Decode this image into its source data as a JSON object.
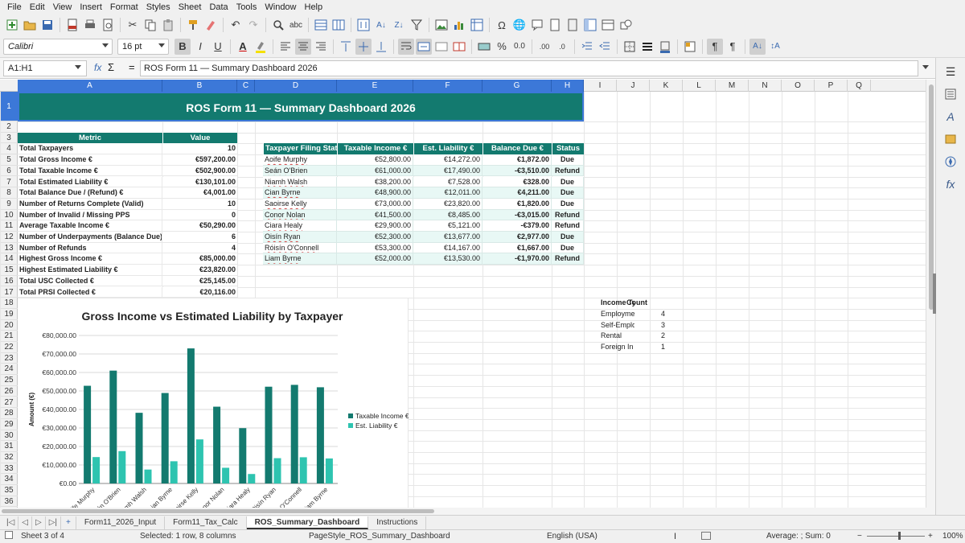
{
  "menu": [
    "File",
    "Edit",
    "View",
    "Insert",
    "Format",
    "Styles",
    "Sheet",
    "Data",
    "Tools",
    "Window",
    "Help"
  ],
  "font": {
    "name": "Calibri",
    "size": "16 pt"
  },
  "namebox": "A1:H1",
  "formula_symbols": {
    "fx": "fx",
    "sigma": "Σ",
    "equals": "="
  },
  "formula": "ROS Form 11 — Summary Dashboard 2026",
  "columns": [
    "A",
    "B",
    "C",
    "D",
    "E",
    "F",
    "G",
    "H",
    "I",
    "J",
    "K",
    "L",
    "M",
    "N",
    "O",
    "P",
    "Q"
  ],
  "rows": [
    "1",
    "2",
    "3",
    "4",
    "5",
    "6",
    "7",
    "8",
    "9",
    "10",
    "11",
    "12",
    "13",
    "14",
    "15",
    "16",
    "17",
    "18",
    "19",
    "20",
    "21",
    "22",
    "23",
    "24",
    "25",
    "26",
    "27",
    "28",
    "29",
    "30",
    "31",
    "32",
    "33",
    "34",
    "35",
    "36"
  ],
  "title": "ROS Form 11 — Summary Dashboard 2026",
  "metrics": {
    "header": [
      "Metric",
      "Value"
    ],
    "rows": [
      [
        "Total Taxpayers",
        "10"
      ],
      [
        "Total Gross Income €",
        "€597,200.00"
      ],
      [
        "Total Taxable Income €",
        "€502,900.00"
      ],
      [
        "Total Estimated Liability €",
        "€130,101.00"
      ],
      [
        "Total Balance Due / (Refund) €",
        "€4,001.00"
      ],
      [
        "Number of Returns Complete (Valid)",
        "10"
      ],
      [
        "Number of Invalid / Missing PPS",
        "0"
      ],
      [
        "Average Taxable Income €",
        "€50,290.00"
      ],
      [
        "Number of Underpayments (Balance Due)",
        "6"
      ],
      [
        "Number of Refunds",
        "4"
      ],
      [
        "Highest Gross Income €",
        "€85,000.00"
      ],
      [
        "Highest Estimated Liability €",
        "€23,820.00"
      ],
      [
        "Total USC Collected €",
        "€25,145.00"
      ],
      [
        "Total PRSI Collected €",
        "€20,116.00"
      ]
    ]
  },
  "status_table": {
    "header": [
      "Taxpayer Filing Status",
      "Taxable Income €",
      "Est. Liability €",
      "Balance Due €",
      "Status"
    ],
    "rows": [
      [
        "Aoife Murphy",
        "€52,800.00",
        "€14,272.00",
        "€1,872.00",
        "Due"
      ],
      [
        "Seán O'Brien",
        "€61,000.00",
        "€17,490.00",
        "-€3,510.00",
        "Refund"
      ],
      [
        "Niamh Walsh",
        "€38,200.00",
        "€7,528.00",
        "€328.00",
        "Due"
      ],
      [
        "Cian Byrne",
        "€48,900.00",
        "€12,011.00",
        "€4,211.00",
        "Due"
      ],
      [
        "Saoirse Kelly",
        "€73,000.00",
        "€23,820.00",
        "€1,820.00",
        "Due"
      ],
      [
        "Conor Nolan",
        "€41,500.00",
        "€8,485.00",
        "-€3,015.00",
        "Refund"
      ],
      [
        "Ciara Healy",
        "€29,900.00",
        "€5,121.00",
        "-€379.00",
        "Refund"
      ],
      [
        "Oisín Ryan",
        "€52,300.00",
        "€13,677.00",
        "€2,977.00",
        "Due"
      ],
      [
        "Róisín O'Connell",
        "€53,300.00",
        "€14,167.00",
        "€1,667.00",
        "Due"
      ],
      [
        "Liam Byrne",
        "€52,000.00",
        "€13,530.00",
        "-€1,970.00",
        "Refund"
      ]
    ]
  },
  "income_types": {
    "header": [
      "Income Ty",
      "Count"
    ],
    "rows": [
      [
        "Employme",
        "4"
      ],
      [
        "Self-Emplo",
        "3"
      ],
      [
        "Rental",
        "2"
      ],
      [
        "Foreign In",
        "1"
      ]
    ]
  },
  "chart_data": {
    "type": "bar",
    "title": "Gross Income vs Estimated Liability by Taxpayer",
    "ylabel": "Amount (€)",
    "xlabel": "",
    "ylim": [
      0,
      80000
    ],
    "yticks": [
      "€0.00",
      "€10,000.00",
      "€20,000.00",
      "€30,000.00",
      "€40,000.00",
      "€50,000.00",
      "€60,000.00",
      "€70,000.00",
      "€80,000.00"
    ],
    "categories": [
      "Aoife Murphy",
      "Seán O'Brien",
      "Niamh Walsh",
      "Cian Byrne",
      "Saoirse Kelly",
      "Conor Nolan",
      "Ciara Healy",
      "Oisín Ryan",
      "O'Connell",
      "Liam Byrne"
    ],
    "category_labels": [
      "ife Murphy",
      "án O'Brien",
      "amh Walsh",
      "ian Byrne",
      "oirse Kelly",
      "onor Nolan",
      "iara Healy",
      "Oisín Ryan",
      "O'Connell",
      "Liam Byrne"
    ],
    "series": [
      {
        "name": "Taxable Income €",
        "color": "#137a6f",
        "values": [
          52800,
          61000,
          38200,
          48900,
          73000,
          41500,
          29900,
          52300,
          53300,
          52000
        ]
      },
      {
        "name": "Est. Liability €",
        "color": "#2ec4b0",
        "values": [
          14272,
          17490,
          7528,
          12011,
          23820,
          8485,
          5121,
          13677,
          14167,
          13530
        ]
      }
    ],
    "legend_position": "right",
    "grid": true
  },
  "tabs": [
    "Form11_2026_Input",
    "Form11_Tax_Calc",
    "ROS_Summary_Dashboard",
    "Instructions"
  ],
  "active_tab": "ROS_Summary_Dashboard",
  "status": {
    "sheet": "Sheet 3 of 4",
    "selection": "Selected: 1 row, 8 columns",
    "pagestyle": "PageStyle_ROS_Summary_Dashboard",
    "language": "English (USA)",
    "summary": "Average: ; Sum: 0",
    "zoom": "100%"
  },
  "colors": {
    "teal": "#137a6f",
    "light_teal": "#2ec4b0",
    "zebra": "#e8f8f5",
    "selection": "#3c78d8"
  }
}
